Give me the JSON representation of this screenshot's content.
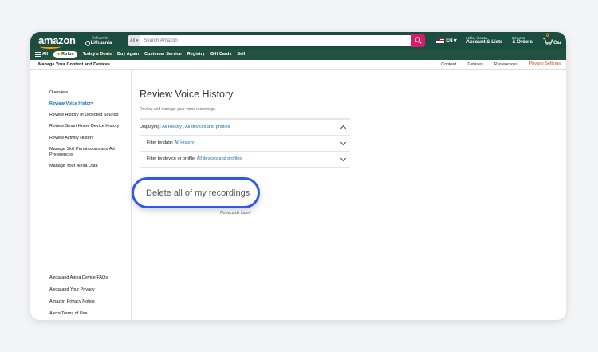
{
  "topnav": {
    "logo": "amazon",
    "deliver_line1": "Deliver to",
    "deliver_line2": "Lithuania",
    "search_category": "All",
    "search_placeholder": "Search Amazon",
    "language": "EN",
    "account_line1": "Hello, Violeta",
    "account_line2": "Account & Lists",
    "returns_line1": "Returns",
    "returns_line2": "& Orders",
    "cart_count": "0",
    "cart_label": "Car"
  },
  "subnav": {
    "all_label": "All",
    "rufus_label": "Rufus",
    "items": [
      "Today's Deals",
      "Buy Again",
      "Customer Service",
      "Registry",
      "Gift Cards",
      "Sell"
    ]
  },
  "tabs": {
    "main": "Manage Your Content and Devices",
    "items": [
      "Content",
      "Devices",
      "Preferences",
      "Privacy Settings"
    ]
  },
  "sidebar": {
    "items": [
      "Overview",
      "Review Voice History",
      "Review History of Detected Sounds",
      "Review Smart Home Device History",
      "Review Activity History",
      "Manage Skill Permissions and Ad Preferences",
      "Manage Your Alexa Data"
    ],
    "bottom_items": [
      "Alexa and Alexa Device FAQs",
      "Alexa and Your Privacy",
      "Amazon Privacy Notice",
      "Alexa Terms of Use"
    ]
  },
  "main": {
    "title": "Review Voice History",
    "subtitle": "Review and manage your voice recordings.",
    "displaying_label": "Displaying:",
    "displaying_value": "All History , All devices and profiles",
    "date_label": "Filter by date:",
    "date_value": "All History",
    "device_label": "Filter by device or profile:",
    "device_value": "All devices and profiles",
    "no_records": "No records found",
    "delete_label": "Delete all of my recordings"
  },
  "colors": {
    "nav_bg": "#1b4d3e",
    "search_button": "#d61c6c",
    "active_tab": "#c7511f",
    "link": "#0f6db8",
    "highlight_ring": "#2f59e6"
  }
}
